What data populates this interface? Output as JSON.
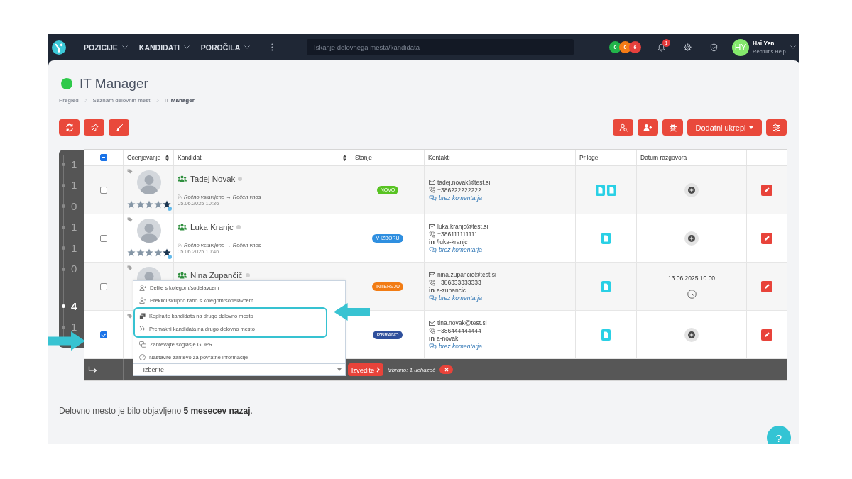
{
  "navbar": {
    "menu": [
      {
        "label": "POZICIJE"
      },
      {
        "label": "KANDIDATI"
      },
      {
        "label": "POROČILA"
      }
    ],
    "search": {
      "placeholder": "Iskanje delovnega mesta/kandidata"
    },
    "counters": [
      {
        "label": "0",
        "color": "#22b44a"
      },
      {
        "label": "0",
        "color": "#f47b16"
      },
      {
        "label": "6",
        "color": "#e6403d"
      }
    ],
    "notifications": {
      "badge": "1"
    },
    "user": {
      "initials": "HY",
      "name": "Hai Yen",
      "company": "Recruitis Help"
    }
  },
  "header": {
    "title": "IT Manager",
    "active": true,
    "breadcrumb": [
      {
        "label": "Pregled",
        "current": false
      },
      {
        "label": "Seznam delovnih mest",
        "current": false
      },
      {
        "label": "IT Manager",
        "current": true
      }
    ]
  },
  "toolbar": {
    "more_actions": {
      "label": "Dodatni ukrepi"
    }
  },
  "side_counter": [
    {
      "label": "1",
      "selected": false
    },
    {
      "label": "1",
      "selected": false
    },
    {
      "label": "0",
      "selected": false
    },
    {
      "label": "1",
      "selected": false
    },
    {
      "label": "1",
      "selected": false
    },
    {
      "label": "0",
      "selected": false
    },
    {
      "label": "4",
      "selected": true
    },
    {
      "label": "1",
      "selected": false
    }
  ],
  "table": {
    "select_all": {
      "indeterminate": true
    },
    "columns": [
      {
        "label": "Ocenjevanje",
        "sortable": true
      },
      {
        "label": "Kandidati",
        "sortable": true
      },
      {
        "label": "Stanje",
        "sortable": false
      },
      {
        "label": "Kontakti",
        "sortable": false
      },
      {
        "label": "Priloge",
        "sortable": false
      },
      {
        "label": "Datum razgovora",
        "sortable": false
      }
    ],
    "rows": [
      {
        "selected": false,
        "avatar": true,
        "stars": 1,
        "name": "Tadej Novak",
        "source": "Ročno vstavljeno → Ročen vnos",
        "added": "05.06.2025 10:36",
        "status": {
          "label": "NOVO",
          "color": "#58c322"
        },
        "contacts": [
          {
            "kind": "email",
            "text": "tadej.novak@test.si"
          },
          {
            "kind": "phone",
            "text": "+386222222222"
          },
          {
            "kind": "comment",
            "text": "brez komentarja"
          }
        ],
        "attachments": [
          {
            "kind": "document"
          },
          {
            "kind": "document"
          }
        ]
      },
      {
        "selected": false,
        "avatar": true,
        "stars": 1,
        "name": "Luka Kranjc",
        "source": "Ročno vstavljeno → Ročen vnos",
        "added": "05.06.2025 10:46",
        "status": {
          "label": "V IZBORU",
          "color": "#2f8fe0"
        },
        "contacts": [
          {
            "kind": "email",
            "text": "luka.kranjc@test.si"
          },
          {
            "kind": "phone",
            "text": "+386111111111"
          },
          {
            "kind": "linkedin",
            "icon": "in",
            "text": "/luka-kranjc"
          },
          {
            "kind": "comment",
            "text": "brez komentarja"
          }
        ],
        "attachments": [
          {
            "kind": "document"
          }
        ]
      },
      {
        "selected": false,
        "avatar": true,
        "name": "Nina Zupančič",
        "status": {
          "label": "INTERVJU",
          "color": "#f27c14"
        },
        "contacts": [
          {
            "kind": "email",
            "text": "nina.zupancic@test.si"
          },
          {
            "kind": "phone",
            "text": "+386333333333"
          },
          {
            "kind": "linkedin",
            "icon": "in",
            "text": "a-zupancic"
          },
          {
            "kind": "comment",
            "text": "brez komentarja"
          }
        ],
        "attachments": [
          {
            "kind": "document"
          }
        ],
        "interview": "13.06.2025 10:00"
      },
      {
        "selected": true,
        "avatar": false,
        "status": {
          "label": "IZBRANO",
          "color": "#2e4f9c"
        },
        "contacts": [
          {
            "kind": "email",
            "text": "tina.novak@test.si"
          },
          {
            "kind": "phone",
            "text": "+386444444444"
          },
          {
            "kind": "linkedin",
            "icon": "in",
            "text": "a-novak"
          },
          {
            "kind": "comment",
            "text": "brez komentarja"
          }
        ],
        "attachments": [
          {
            "kind": "document"
          }
        ]
      }
    ]
  },
  "bulk_bar": {
    "action_select": {
      "value": "- Izberite -",
      "open": true,
      "options": [
        {
          "kind": "share",
          "label": "Delite s kolegom/sodelavcem",
          "highlighted": false
        },
        {
          "kind": "unshare",
          "label": "Prekliči skupno rabo s kolegom/sodelavcem",
          "highlighted": false
        },
        {
          "kind": "copy",
          "label": "Kopirajte kandidata na drugo delovno mesto",
          "highlighted": true
        },
        {
          "kind": "move",
          "label": "Premakni kandidata na drugo delovno mesto",
          "highlighted": true
        },
        {
          "kind": "gdpr",
          "label": "Zahtevajte soglasje GDPR",
          "highlighted": false
        },
        {
          "kind": "feedback",
          "label": "Nastavite zahtevo za povratne informacije",
          "highlighted": false
        }
      ]
    },
    "run_button": {
      "label": "Izvedite"
    },
    "selection": "izbrano: 1 uchazeč"
  },
  "footer": {
    "note": "Delovno mesto je bilo objavljeno **5 mesecev nazaj**."
  },
  "help_button": {
    "label": "?"
  },
  "callouts": [
    {
      "kind": "arrow_right"
    },
    {
      "kind": "arrow_left"
    }
  ]
}
